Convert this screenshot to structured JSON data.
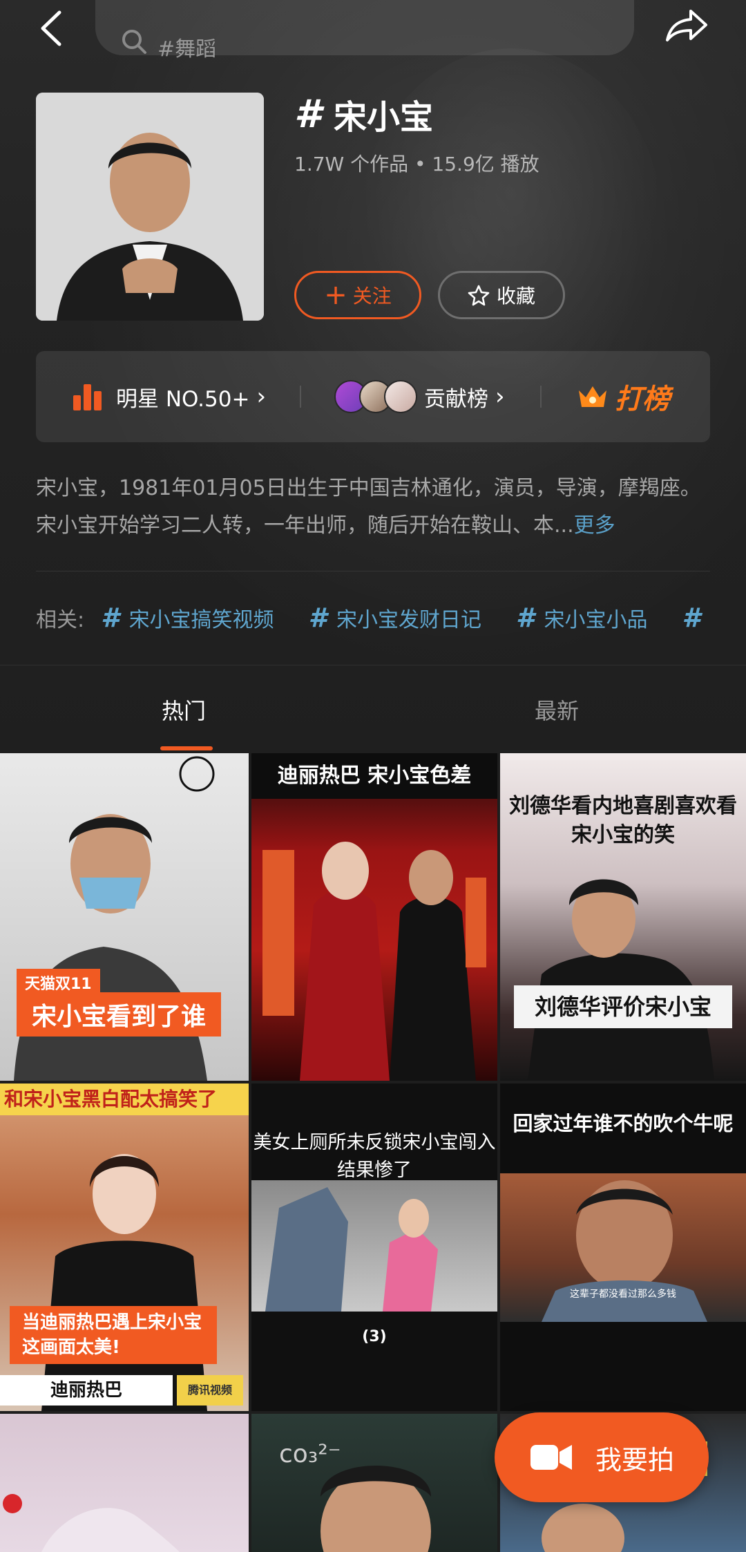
{
  "search": {
    "placeholder": "#舞蹈"
  },
  "topic": {
    "title": "宋小宝",
    "stats": "1.7W 个作品 • 15.9亿 播放",
    "follow_label": "关注",
    "collect_label": "收藏"
  },
  "rank": {
    "star_label": "明星 NO.50+",
    "contrib_label": "贡献榜",
    "dabang_label": "打榜"
  },
  "description": {
    "text": "宋小宝，1981年01月05日出生于中国吉林通化，演员，导演，摩羯座。宋小宝开始学习二人转，一年出师，随后开始在鞍山、本...",
    "more_label": "更多"
  },
  "related": {
    "label": "相关:",
    "tags": [
      "宋小宝搞笑视频",
      "宋小宝发财日记",
      "宋小宝小品"
    ]
  },
  "tabs": {
    "hot": "热门",
    "latest": "最新"
  },
  "videos": [
    {
      "caption_small": "天猫双11",
      "caption": "宋小宝看到了谁"
    },
    {
      "caption": "迪丽热巴 宋小宝色差"
    },
    {
      "caption_top": "刘德华看内地喜剧喜欢看宋小宝的笑",
      "caption_bottom": "刘德华评价宋小宝"
    },
    {
      "caption_top": "和宋小宝黑白配太搞笑了",
      "caption": "当迪丽热巴遇上宋小宝这画面太美!",
      "caption_bottom": "迪丽热巴",
      "source": "腾讯视频"
    },
    {
      "caption": "美女上厕所未反锁宋小宝闯入结果惨了",
      "tag": "(3)"
    },
    {
      "caption": "回家过年谁不的吹个牛呢",
      "subtitle": "这辈子都没看过那么多钱"
    },
    {
      "caption": ""
    },
    {
      "caption": ""
    },
    {
      "caption": ""
    }
  ],
  "fab": {
    "shoot_label": "我要拍"
  },
  "colors": {
    "accent": "#f15a22",
    "link": "#5fa6cf"
  }
}
